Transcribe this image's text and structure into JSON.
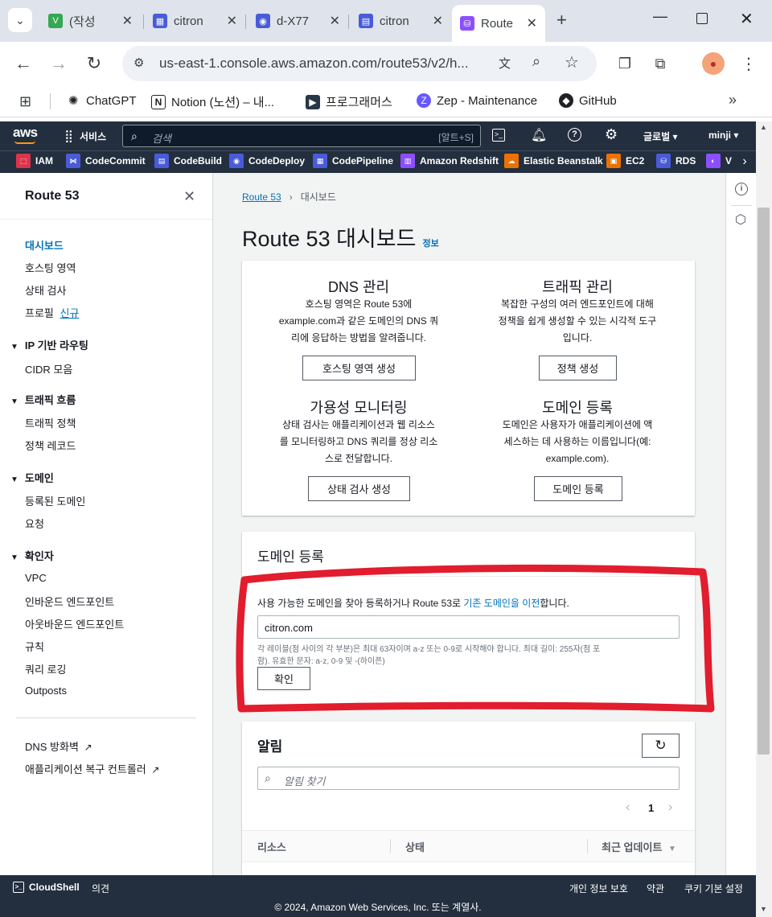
{
  "browser": {
    "tabs": [
      {
        "label": "(작성",
        "icon": "v-icon",
        "color": "#34a853"
      },
      {
        "label": "citron",
        "icon": "codepipeline-icon",
        "color": "#4a5bd8"
      },
      {
        "label": "d-X77",
        "icon": "codedeploy-icon",
        "color": "#4a5bd8"
      },
      {
        "label": "citron",
        "icon": "codebuild-icon",
        "color": "#4a5bd8"
      },
      {
        "label": "Route",
        "icon": "route53-icon",
        "color": "#8c4fff"
      }
    ],
    "url": "us-east-1.console.aws.amazon.com/route53/v2/h...",
    "bookmarks": [
      "ChatGPT",
      "Notion (노션) – 내...",
      "프로그래머스",
      "Zep - Maintenance",
      "GitHub"
    ]
  },
  "aws_header": {
    "logo": "aws",
    "services_label": "서비스",
    "search_placeholder": "검색",
    "search_shortcut": "[알트+S]",
    "region": "글로벌 ▾",
    "user": "minji ▾",
    "services": [
      "IAM",
      "CodeCommit",
      "CodeBuild",
      "CodeDeploy",
      "CodePipeline",
      "Amazon Redshift",
      "Elastic Beanstalk",
      "EC2",
      "RDS",
      "V"
    ]
  },
  "sidebar": {
    "title": "Route 53",
    "items": [
      "대시보드",
      "호스팅 영역",
      "상태 검사",
      "프로필"
    ],
    "new_badge": "신규",
    "groups": [
      {
        "title": "IP 기반 라우팅",
        "items": [
          "CIDR 모음"
        ]
      },
      {
        "title": "트래픽 흐름",
        "items": [
          "트래픽 정책",
          "정책 레코드"
        ]
      },
      {
        "title": "도메인",
        "items": [
          "등록된 도메인",
          "요청"
        ]
      },
      {
        "title": "확인자",
        "items": [
          "VPC",
          "인바운드 엔드포인트",
          "아웃바운드 엔드포인트",
          "규칙",
          "쿼리 로깅",
          "Outposts"
        ]
      }
    ],
    "external": [
      "DNS 방화벽",
      "애플리케이션 복구 컨트롤러"
    ]
  },
  "breadcrumb": {
    "root": "Route 53",
    "current": "대시보드"
  },
  "page": {
    "title": "Route 53 대시보드",
    "info": "정보"
  },
  "dashboard": [
    {
      "title": "DNS 관리",
      "lines": [
        "호스팅 영역은 Route 53에",
        "example.com과 같은 도메인의 DNS 쿼",
        "리에 응답하는 방법을 알려줍니다."
      ],
      "button": "호스팅 영역 생성"
    },
    {
      "title": "트래픽 관리",
      "lines": [
        "복잡한 구성의 여러 엔드포인트에 대해",
        "정책을 쉽게 생성할 수 있는 시각적 도구",
        "입니다."
      ],
      "button": "정책 생성"
    },
    {
      "title": "가용성 모니터링",
      "lines": [
        "상태 검사는 애플리케이션과 웹 리소스",
        "를 모니터링하고 DNS 쿼리를 정상 리소",
        "스로 전달합니다."
      ],
      "button": "상태 검사 생성"
    },
    {
      "title": "도메인 등록",
      "lines": [
        "도메인은 사용자가 애플리케이션에 액",
        "세스하는 데 사용하는 이름입니다(예:",
        "example.com)."
      ],
      "button": "도메인 등록"
    }
  ],
  "domain_register": {
    "title": "도메인 등록",
    "desc_before": "사용 가능한 도메인을 찾아 등록하거나 Route 53로 ",
    "desc_link": "기존 도메인을 이전",
    "desc_after": "합니다.",
    "input_value": "citron.com",
    "hint1": "각 레이블(점 사이의 각 부분)은 최대 63자이며 a-z 또는 0-9로 시작해야 합니다. 최대 길이: 255자(점 포",
    "hint2": "함). 유효한 문자: a-z, 0-9 및 -(하이픈)",
    "confirm": "확인"
  },
  "alerts": {
    "title": "알림",
    "search_placeholder": "알림 찾기",
    "page": "1",
    "columns": [
      "리소스",
      "상태",
      "최근 업데이트"
    ]
  },
  "footer": {
    "cloudshell": "CloudShell",
    "feedback": "의견",
    "privacy": "개인 정보 보호",
    "terms": "약관",
    "cookie": "쿠키 기본 설정",
    "copyright": "© 2024, Amazon Web Services, Inc. 또는 계열사."
  },
  "colors": {
    "accent": "#0073bb",
    "header": "#232f3e",
    "annotation": "#e11d2e"
  }
}
